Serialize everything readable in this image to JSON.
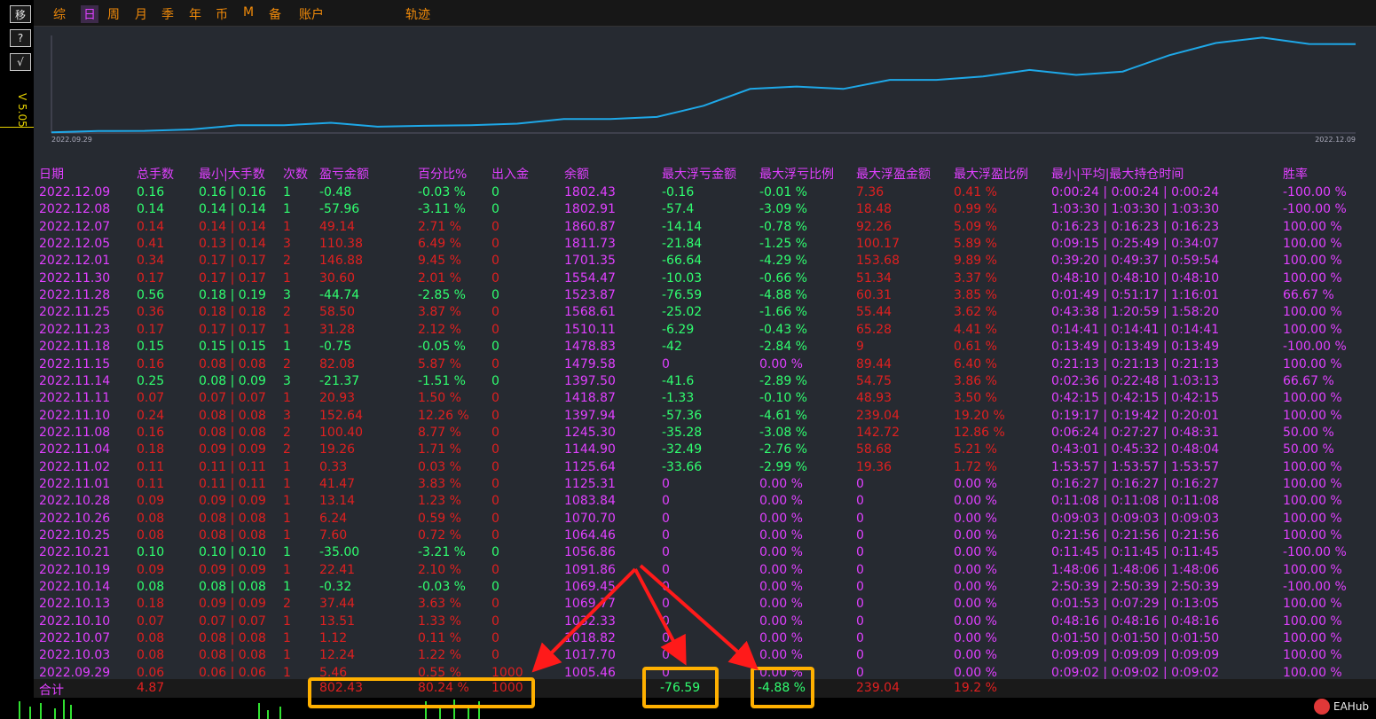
{
  "sidebar": {
    "buttons": [
      {
        "label": "移",
        "name": "move-button"
      },
      {
        "label": "?",
        "name": "help-button"
      },
      {
        "label": "√",
        "name": "check-button"
      }
    ],
    "version": "V 5.05"
  },
  "tabs": [
    {
      "label": "综",
      "name": "tab-summary",
      "active": false
    },
    {
      "label": "日",
      "name": "tab-day",
      "active": true
    },
    {
      "label": "周",
      "name": "tab-week",
      "active": false
    },
    {
      "label": "月",
      "name": "tab-month",
      "active": false
    },
    {
      "label": "季",
      "name": "tab-quarter",
      "active": false
    },
    {
      "label": "年",
      "name": "tab-year",
      "active": false
    },
    {
      "label": "币",
      "name": "tab-currency",
      "active": false
    },
    {
      "label": "M",
      "name": "tab-magic",
      "active": false
    },
    {
      "label": "备",
      "name": "tab-notes",
      "active": false
    },
    {
      "label": "账户",
      "name": "tab-account",
      "active": false
    },
    {
      "label": "轨迹",
      "name": "tab-track",
      "active": false
    }
  ],
  "chart_data": {
    "type": "line",
    "x_start_label": "2022.09.29",
    "x_end_label": "2022.12.09",
    "series": [
      {
        "values": [
          1005.46,
          1017.7,
          1018.82,
          1032.33,
          1069.77,
          1069.45,
          1091.86,
          1056.86,
          1064.46,
          1070.7,
          1083.84,
          1125.31,
          1125.64,
          1144.9,
          1245.3,
          1397.94,
          1418.87,
          1397.5,
          1479.58,
          1478.83,
          1510.11,
          1568.61,
          1523.87,
          1554.47,
          1701.35,
          1811.73,
          1860.87,
          1802.91,
          1802.43
        ]
      }
    ],
    "ylim": [
      1000,
      1880
    ],
    "color": "#1ea8e8"
  },
  "headers": [
    "日期",
    "总手数",
    "最小|大手数",
    "次数",
    "盈亏金额",
    "百分比%",
    "出入金",
    "余额",
    "最大浮亏金额",
    "最大浮亏比例",
    "最大浮盈金额",
    "最大浮盈比例",
    "最小|平均|最大持仓时间",
    "胜率"
  ],
  "rows": [
    [
      "2022.12.09",
      "0.16",
      "0.16 | 0.16",
      "1",
      "-0.48",
      "-0.03 %",
      "0",
      "1802.43",
      "-0.16",
      "-0.01 %",
      "7.36",
      "0.41 %",
      "0:00:24 | 0:00:24 | 0:00:24",
      "-100.00 %"
    ],
    [
      "2022.12.08",
      "0.14",
      "0.14 | 0.14",
      "1",
      "-57.96",
      "-3.11 %",
      "0",
      "1802.91",
      "-57.4",
      "-3.09 %",
      "18.48",
      "0.99 %",
      "1:03:30 | 1:03:30 | 1:03:30",
      "-100.00 %"
    ],
    [
      "2022.12.07",
      "0.14",
      "0.14 | 0.14",
      "1",
      "49.14",
      "2.71 %",
      "0",
      "1860.87",
      "-14.14",
      "-0.78 %",
      "92.26",
      "5.09 %",
      "0:16:23 | 0:16:23 | 0:16:23",
      "100.00 %"
    ],
    [
      "2022.12.05",
      "0.41",
      "0.13 | 0.14",
      "3",
      "110.38",
      "6.49 %",
      "0",
      "1811.73",
      "-21.84",
      "-1.25 %",
      "100.17",
      "5.89 %",
      "0:09:15 | 0:25:49 | 0:34:07",
      "100.00 %"
    ],
    [
      "2022.12.01",
      "0.34",
      "0.17 | 0.17",
      "2",
      "146.88",
      "9.45 %",
      "0",
      "1701.35",
      "-66.64",
      "-4.29 %",
      "153.68",
      "9.89 %",
      "0:39:20 | 0:49:37 | 0:59:54",
      "100.00 %"
    ],
    [
      "2022.11.30",
      "0.17",
      "0.17 | 0.17",
      "1",
      "30.60",
      "2.01 %",
      "0",
      "1554.47",
      "-10.03",
      "-0.66 %",
      "51.34",
      "3.37 %",
      "0:48:10 | 0:48:10 | 0:48:10",
      "100.00 %"
    ],
    [
      "2022.11.28",
      "0.56",
      "0.18 | 0.19",
      "3",
      "-44.74",
      "-2.85 %",
      "0",
      "1523.87",
      "-76.59",
      "-4.88 %",
      "60.31",
      "3.85 %",
      "0:01:49 | 0:51:17 | 1:16:01",
      "66.67 %"
    ],
    [
      "2022.11.25",
      "0.36",
      "0.18 | 0.18",
      "2",
      "58.50",
      "3.87 %",
      "0",
      "1568.61",
      "-25.02",
      "-1.66 %",
      "55.44",
      "3.62 %",
      "0:43:38 | 1:20:59 | 1:58:20",
      "100.00 %"
    ],
    [
      "2022.11.23",
      "0.17",
      "0.17 | 0.17",
      "1",
      "31.28",
      "2.12 %",
      "0",
      "1510.11",
      "-6.29",
      "-0.43 %",
      "65.28",
      "4.41 %",
      "0:14:41 | 0:14:41 | 0:14:41",
      "100.00 %"
    ],
    [
      "2022.11.18",
      "0.15",
      "0.15 | 0.15",
      "1",
      "-0.75",
      "-0.05 %",
      "0",
      "1478.83",
      "-42",
      "-2.84 %",
      "9",
      "0.61 %",
      "0:13:49 | 0:13:49 | 0:13:49",
      "-100.00 %"
    ],
    [
      "2022.11.15",
      "0.16",
      "0.08 | 0.08",
      "2",
      "82.08",
      "5.87 %",
      "0",
      "1479.58",
      "0",
      "0.00 %",
      "89.44",
      "6.40 %",
      "0:21:13 | 0:21:13 | 0:21:13",
      "100.00 %"
    ],
    [
      "2022.11.14",
      "0.25",
      "0.08 | 0.09",
      "3",
      "-21.37",
      "-1.51 %",
      "0",
      "1397.50",
      "-41.6",
      "-2.89 %",
      "54.75",
      "3.86 %",
      "0:02:36 | 0:22:48 | 1:03:13",
      "66.67 %"
    ],
    [
      "2022.11.11",
      "0.07",
      "0.07 | 0.07",
      "1",
      "20.93",
      "1.50 %",
      "0",
      "1418.87",
      "-1.33",
      "-0.10 %",
      "48.93",
      "3.50 %",
      "0:42:15 | 0:42:15 | 0:42:15",
      "100.00 %"
    ],
    [
      "2022.11.10",
      "0.24",
      "0.08 | 0.08",
      "3",
      "152.64",
      "12.26 %",
      "0",
      "1397.94",
      "-57.36",
      "-4.61 %",
      "239.04",
      "19.20 %",
      "0:19:17 | 0:19:42 | 0:20:01",
      "100.00 %"
    ],
    [
      "2022.11.08",
      "0.16",
      "0.08 | 0.08",
      "2",
      "100.40",
      "8.77 %",
      "0",
      "1245.30",
      "-35.28",
      "-3.08 %",
      "142.72",
      "12.86 %",
      "0:06:24 | 0:27:27 | 0:48:31",
      "50.00 %"
    ],
    [
      "2022.11.04",
      "0.18",
      "0.09 | 0.09",
      "2",
      "19.26",
      "1.71 %",
      "0",
      "1144.90",
      "-32.49",
      "-2.76 %",
      "58.68",
      "5.21 %",
      "0:43:01 | 0:45:32 | 0:48:04",
      "50.00 %"
    ],
    [
      "2022.11.02",
      "0.11",
      "0.11 | 0.11",
      "1",
      "0.33",
      "0.03 %",
      "0",
      "1125.64",
      "-33.66",
      "-2.99 %",
      "19.36",
      "1.72 %",
      "1:53:57 | 1:53:57 | 1:53:57",
      "100.00 %"
    ],
    [
      "2022.11.01",
      "0.11",
      "0.11 | 0.11",
      "1",
      "41.47",
      "3.83 %",
      "0",
      "1125.31",
      "0",
      "0.00 %",
      "0",
      "0.00 %",
      "0:16:27 | 0:16:27 | 0:16:27",
      "100.00 %"
    ],
    [
      "2022.10.28",
      "0.09",
      "0.09 | 0.09",
      "1",
      "13.14",
      "1.23 %",
      "0",
      "1083.84",
      "0",
      "0.00 %",
      "0",
      "0.00 %",
      "0:11:08 | 0:11:08 | 0:11:08",
      "100.00 %"
    ],
    [
      "2022.10.26",
      "0.08",
      "0.08 | 0.08",
      "1",
      "6.24",
      "0.59 %",
      "0",
      "1070.70",
      "0",
      "0.00 %",
      "0",
      "0.00 %",
      "0:09:03 | 0:09:03 | 0:09:03",
      "100.00 %"
    ],
    [
      "2022.10.25",
      "0.08",
      "0.08 | 0.08",
      "1",
      "7.60",
      "0.72 %",
      "0",
      "1064.46",
      "0",
      "0.00 %",
      "0",
      "0.00 %",
      "0:21:56 | 0:21:56 | 0:21:56",
      "100.00 %"
    ],
    [
      "2022.10.21",
      "0.10",
      "0.10 | 0.10",
      "1",
      "-35.00",
      "-3.21 %",
      "0",
      "1056.86",
      "0",
      "0.00 %",
      "0",
      "0.00 %",
      "0:11:45 | 0:11:45 | 0:11:45",
      "-100.00 %"
    ],
    [
      "2022.10.19",
      "0.09",
      "0.09 | 0.09",
      "1",
      "22.41",
      "2.10 %",
      "0",
      "1091.86",
      "0",
      "0.00 %",
      "0",
      "0.00 %",
      "1:48:06 | 1:48:06 | 1:48:06",
      "100.00 %"
    ],
    [
      "2022.10.14",
      "0.08",
      "0.08 | 0.08",
      "1",
      "-0.32",
      "-0.03 %",
      "0",
      "1069.45",
      "0",
      "0.00 %",
      "0",
      "0.00 %",
      "2:50:39 | 2:50:39 | 2:50:39",
      "-100.00 %"
    ],
    [
      "2022.10.13",
      "0.18",
      "0.09 | 0.09",
      "2",
      "37.44",
      "3.63 %",
      "0",
      "1069.77",
      "0",
      "0.00 %",
      "0",
      "0.00 %",
      "0:01:53 | 0:07:29 | 0:13:05",
      "100.00 %"
    ],
    [
      "2022.10.10",
      "0.07",
      "0.07 | 0.07",
      "1",
      "13.51",
      "1.33 %",
      "0",
      "1032.33",
      "0",
      "0.00 %",
      "0",
      "0.00 %",
      "0:48:16 | 0:48:16 | 0:48:16",
      "100.00 %"
    ],
    [
      "2022.10.07",
      "0.08",
      "0.08 | 0.08",
      "1",
      "1.12",
      "0.11 %",
      "0",
      "1018.82",
      "0",
      "0.00 %",
      "0",
      "0.00 %",
      "0:01:50 | 0:01:50 | 0:01:50",
      "100.00 %"
    ],
    [
      "2022.10.03",
      "0.08",
      "0.08 | 0.08",
      "1",
      "12.24",
      "1.22 %",
      "0",
      "1017.70",
      "0",
      "0.00 %",
      "0",
      "0.00 %",
      "0:09:09 | 0:09:09 | 0:09:09",
      "100.00 %"
    ],
    [
      "2022.09.29",
      "0.06",
      "0.06 | 0.06",
      "1",
      "5.46",
      "0.55 %",
      "1000",
      "1005.46",
      "0",
      "0.00 %",
      "0",
      "0.00 %",
      "0:09:02 | 0:09:02 | 0:09:02",
      "100.00 %"
    ]
  ],
  "total": {
    "label": "合计",
    "lots": "4.87",
    "profit": "802.43",
    "percent": "80.24 %",
    "deposit": "1000",
    "max_float_loss": "-76.59",
    "max_float_loss_pct": "-4.88 %",
    "max_float_profit": "239.04",
    "max_float_profit_pct": "19.2 %"
  },
  "brand": "EAHub"
}
